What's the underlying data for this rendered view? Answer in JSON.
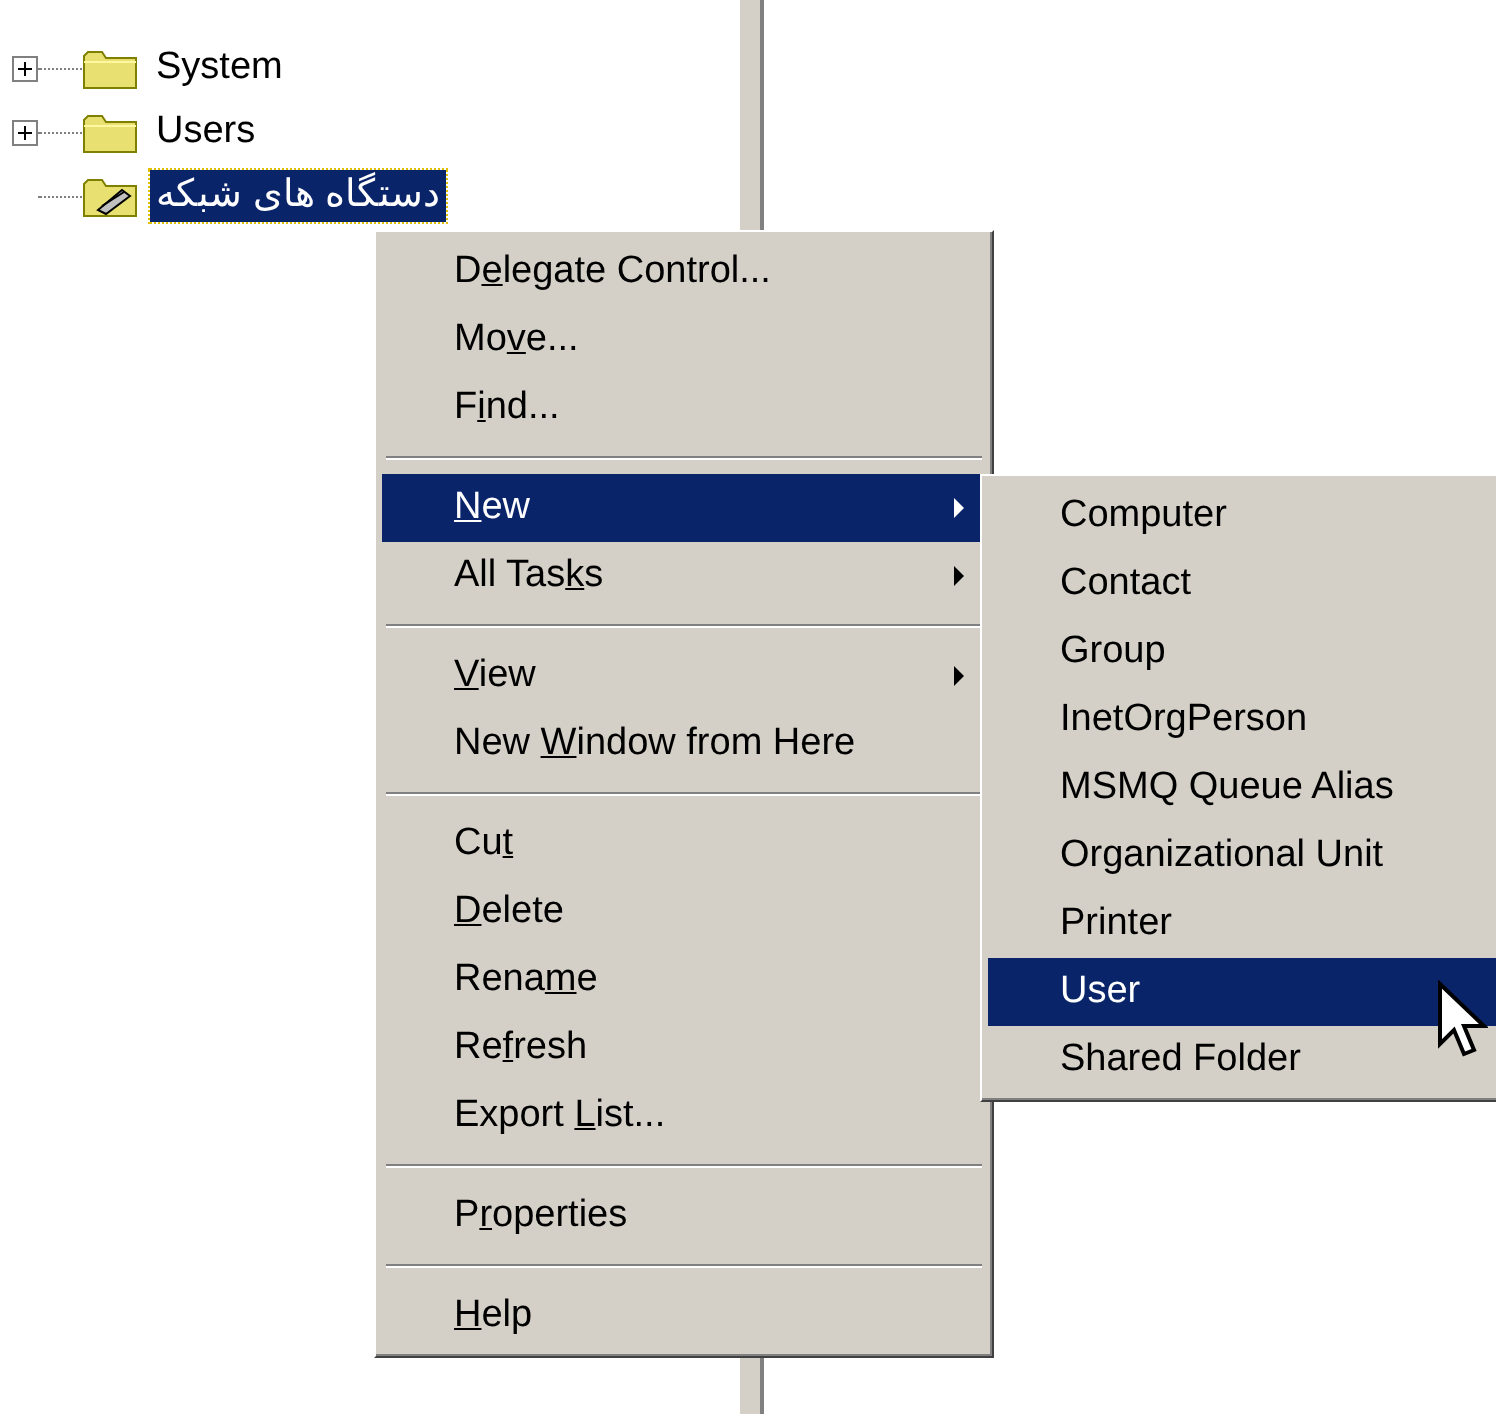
{
  "tree": {
    "items": [
      {
        "label": "System",
        "kind": "folder",
        "expanded": false,
        "selected": false
      },
      {
        "label": "Users",
        "kind": "folder",
        "expanded": false,
        "selected": false
      },
      {
        "label": "دستگاه های شبکه",
        "kind": "unit",
        "selected": true
      }
    ]
  },
  "context_menu": {
    "items": [
      {
        "kind": "item",
        "label": {
          "before": "D",
          "key": "e",
          "after": "legate Control..."
        },
        "submenu": false,
        "selected": false
      },
      {
        "kind": "item",
        "label": {
          "before": "Mo",
          "key": "v",
          "after": "e..."
        },
        "submenu": false,
        "selected": false
      },
      {
        "kind": "item",
        "label": {
          "before": "F",
          "key": "i",
          "after": "nd..."
        },
        "submenu": false,
        "selected": false
      },
      {
        "kind": "separator"
      },
      {
        "kind": "item",
        "label": {
          "key": "N",
          "after": "ew"
        },
        "submenu": true,
        "selected": true
      },
      {
        "kind": "item",
        "label": {
          "before": "All Tas",
          "key": "k",
          "after": "s"
        },
        "submenu": true,
        "selected": false
      },
      {
        "kind": "separator"
      },
      {
        "kind": "item",
        "label": {
          "key": "V",
          "after": "iew"
        },
        "submenu": true,
        "selected": false
      },
      {
        "kind": "item",
        "label": {
          "before": "New ",
          "key": "W",
          "after": "indow from Here"
        },
        "submenu": false,
        "selected": false
      },
      {
        "kind": "separator"
      },
      {
        "kind": "item",
        "label": {
          "before": "Cu",
          "key": "t"
        },
        "submenu": false,
        "selected": false
      },
      {
        "kind": "item",
        "label": {
          "key": "D",
          "after": "elete"
        },
        "submenu": false,
        "selected": false
      },
      {
        "kind": "item",
        "label": {
          "before": "Rena",
          "key": "m",
          "after": "e"
        },
        "submenu": false,
        "selected": false
      },
      {
        "kind": "item",
        "label": {
          "before": "Re",
          "key": "f",
          "after": "resh"
        },
        "submenu": false,
        "selected": false
      },
      {
        "kind": "item",
        "label": {
          "before": "Export ",
          "key": "L",
          "after": "ist..."
        },
        "submenu": false,
        "selected": false
      },
      {
        "kind": "separator"
      },
      {
        "kind": "item",
        "label": {
          "before": "P",
          "key": "r",
          "after": "operties"
        },
        "submenu": false,
        "selected": false
      },
      {
        "kind": "separator"
      },
      {
        "kind": "item",
        "label": {
          "key": "H",
          "after": "elp"
        },
        "submenu": false,
        "selected": false
      }
    ]
  },
  "new_submenu": {
    "items": [
      {
        "label": "Computer",
        "selected": false
      },
      {
        "label": "Contact",
        "selected": false
      },
      {
        "label": "Group",
        "selected": false
      },
      {
        "label": "InetOrgPerson",
        "selected": false
      },
      {
        "label": "MSMQ Queue Alias",
        "selected": false
      },
      {
        "label": "Organizational Unit",
        "selected": false
      },
      {
        "label": "Printer",
        "selected": false
      },
      {
        "label": "User",
        "selected": true
      },
      {
        "label": "Shared Folder",
        "selected": false
      }
    ]
  }
}
